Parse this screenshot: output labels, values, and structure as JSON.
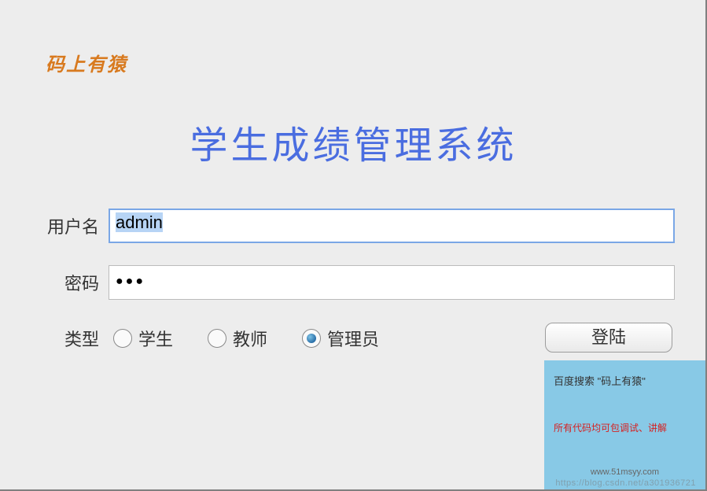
{
  "brand": "码上有猿",
  "title": "学生成绩管理系统",
  "form": {
    "username_label": "用户名",
    "username_value": "admin",
    "password_label": "密码",
    "password_masked": "●●●",
    "type_label": "类型",
    "radios": {
      "student": "学生",
      "teacher": "教师",
      "admin": "管理员"
    },
    "selected_type": "admin",
    "login_button": "登陆"
  },
  "promo": {
    "line1": "百度搜索 \"码上有猿\"",
    "line2": "所有代码均可包调试、讲解",
    "line3": "www.51msyy.com"
  },
  "watermark": "https://blog.csdn.net/a301936721"
}
